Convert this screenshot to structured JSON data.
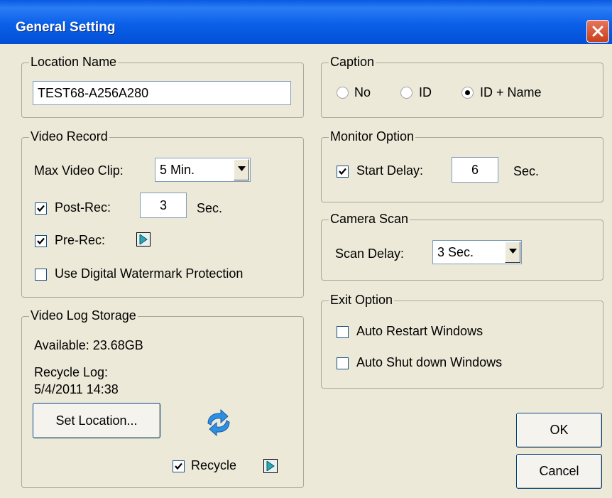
{
  "window": {
    "title": "General Setting"
  },
  "location_name": {
    "legend": "Location Name",
    "value": "TEST68-A256A280"
  },
  "caption": {
    "legend": "Caption",
    "options": [
      {
        "label": "No",
        "selected": false
      },
      {
        "label": "ID",
        "selected": false
      },
      {
        "label": "ID + Name",
        "selected": true
      }
    ]
  },
  "video_record": {
    "legend": "Video Record",
    "max_clip_label": "Max Video Clip:",
    "max_clip_value": "5 Min.",
    "post_rec_label": "Post-Rec:",
    "post_rec_checked": true,
    "post_rec_value": "3",
    "post_rec_unit": "Sec.",
    "pre_rec_label": "Pre-Rec:",
    "pre_rec_checked": true,
    "watermark_label": "Use Digital Watermark Protection",
    "watermark_checked": false
  },
  "monitor_option": {
    "legend": "Monitor Option",
    "start_delay_label": "Start Delay:",
    "start_delay_checked": true,
    "start_delay_value": "6",
    "start_delay_unit": "Sec."
  },
  "camera_scan": {
    "legend": "Camera Scan",
    "scan_delay_label": "Scan Delay:",
    "scan_delay_value": "3 Sec."
  },
  "video_log_storage": {
    "legend": "Video Log Storage",
    "available": "Available: 23.68GB",
    "recycle_log_label": "Recycle Log:",
    "recycle_log_date": "5/4/2011 14:38",
    "set_location_label": "Set Location...",
    "recycle_label": "Recycle",
    "recycle_checked": true
  },
  "exit_option": {
    "legend": "Exit Option",
    "auto_restart_label": "Auto Restart Windows",
    "auto_restart_checked": false,
    "auto_shutdown_label": "Auto Shut down Windows",
    "auto_shutdown_checked": false
  },
  "buttons": {
    "ok": "OK",
    "cancel": "Cancel"
  },
  "colors": {
    "title_bar": "#0a5ae0",
    "dialog_bg": "#ece9d8",
    "close_button": "#d5532f"
  }
}
